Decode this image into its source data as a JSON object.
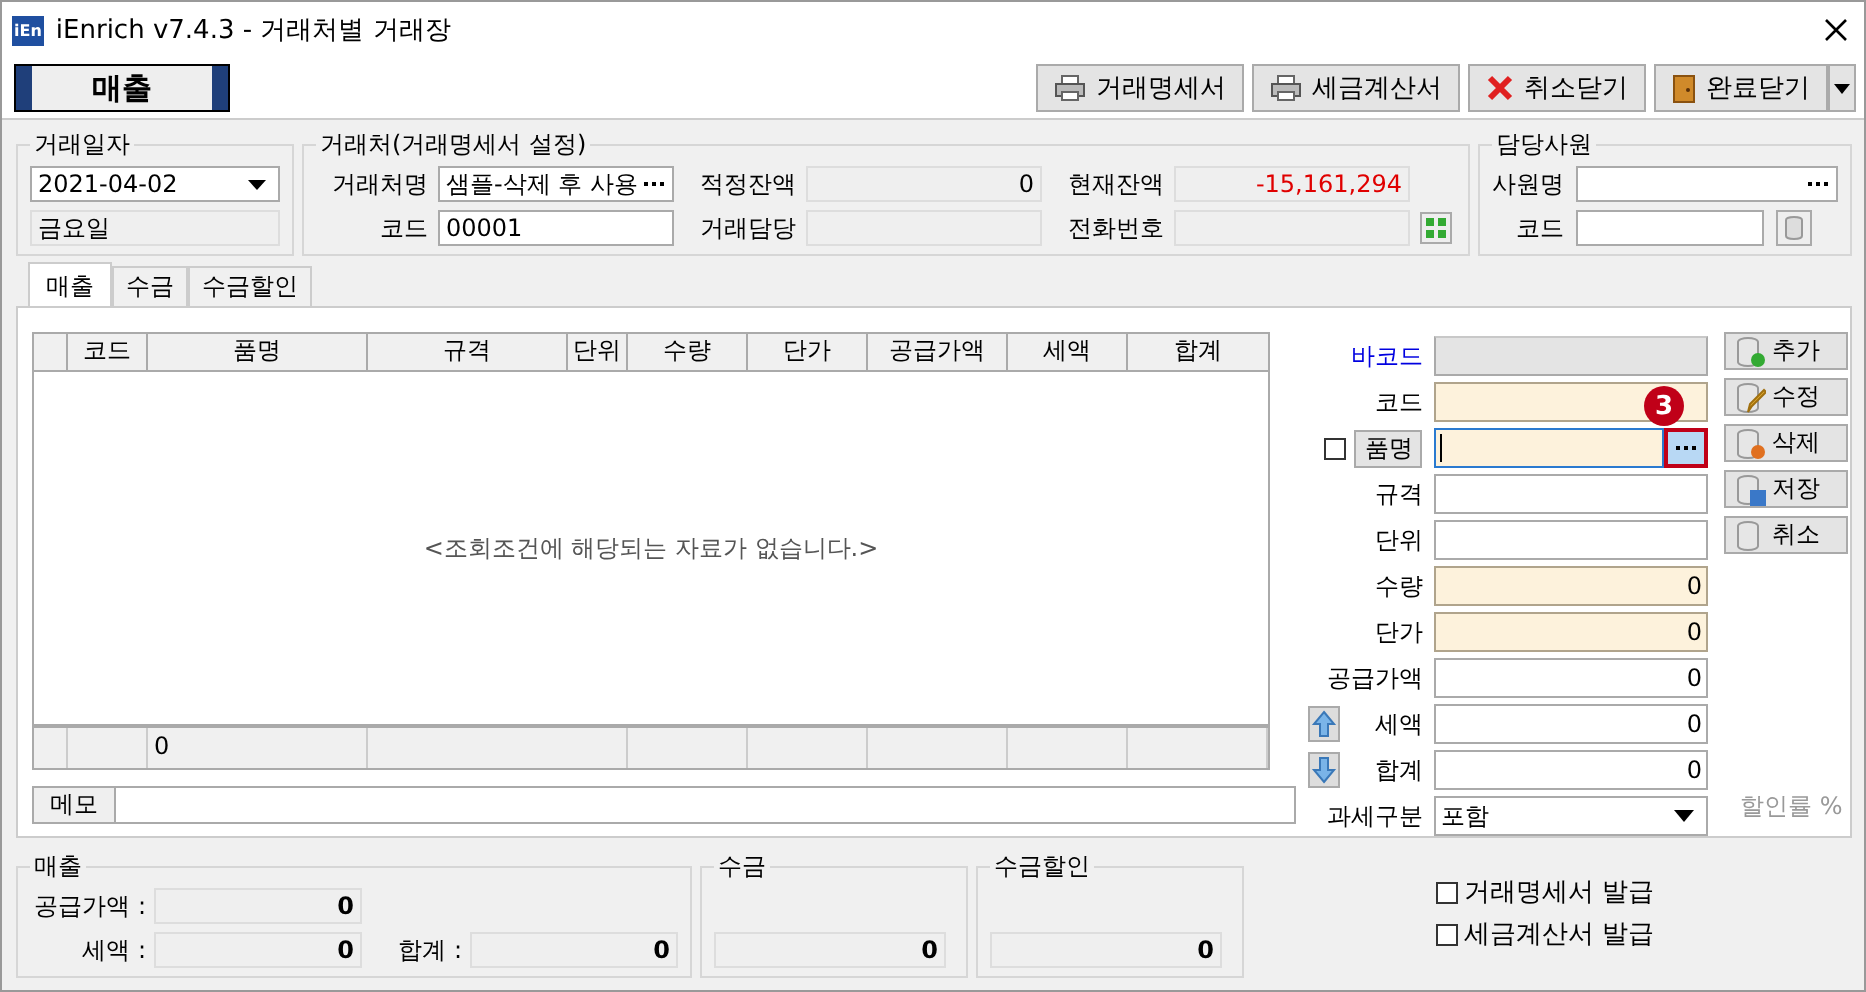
{
  "window": {
    "title": "iEnrich v7.4.3 - 거래처별 거래장",
    "logo": "iEn"
  },
  "mode_label": "매출",
  "toolbar": [
    {
      "label": "거래명세서",
      "kind": "print"
    },
    {
      "label": "세금계산서",
      "kind": "print"
    },
    {
      "label": "취소닫기",
      "kind": "cancel"
    },
    {
      "label": "완료닫기",
      "kind": "door"
    }
  ],
  "date_group": {
    "title": "거래일자",
    "date": "2021-04-02",
    "weekday": "금요일"
  },
  "client_group": {
    "title": "거래처(거래명세서 설정)",
    "name_label": "거래처명",
    "name": "샘플-삭제 후 사용",
    "code_label": "코드",
    "code": "00001",
    "balance_label": "적정잔액",
    "balance": "0",
    "manager_label": "거래담당",
    "current_label": "현재잔액",
    "current": "-15,161,294",
    "phone_label": "전화번호"
  },
  "staff_group": {
    "title": "담당사원",
    "name_label": "사원명",
    "code_label": "코드"
  },
  "tabs": [
    {
      "label": "매출",
      "selected": true
    },
    {
      "label": "수금",
      "selected": false
    },
    {
      "label": "수금할인",
      "selected": false
    }
  ],
  "table": {
    "columns": [
      "코드",
      "품명",
      "규격",
      "단위",
      "수량",
      "단가",
      "공급가액",
      "세액",
      "합계"
    ],
    "empty_message": "<조회조건에 해당되는 자료가 없습니다.>",
    "footer_value": "0"
  },
  "memo_label": "메모",
  "form": [
    {
      "label": "바코드",
      "kind": "link",
      "disabled": true,
      "required": false,
      "focused": false
    },
    {
      "label": "코드",
      "kind": "text",
      "disabled": false,
      "required": true,
      "focused": false
    },
    {
      "label": "품명",
      "kind": "lookup",
      "disabled": false,
      "required": true,
      "focused": true,
      "checked": false,
      "callout": "3"
    },
    {
      "label": "규격",
      "kind": "text",
      "disabled": false,
      "required": false,
      "focused": false
    },
    {
      "label": "단위",
      "kind": "text",
      "disabled": false,
      "required": false,
      "focused": false
    },
    {
      "label": "수량",
      "kind": "text",
      "disabled": false,
      "required": true,
      "focused": false,
      "value": "0"
    },
    {
      "label": "단가",
      "kind": "text",
      "disabled": false,
      "required": true,
      "focused": false,
      "value": "0"
    },
    {
      "label": "공급가액",
      "kind": "text",
      "disabled": false,
      "required": false,
      "focused": false,
      "value": "0"
    },
    {
      "label": "세액",
      "kind": "up",
      "disabled": false,
      "required": false,
      "focused": false,
      "value": "0"
    },
    {
      "label": "합계",
      "kind": "down",
      "disabled": false,
      "required": false,
      "focused": false,
      "value": "0"
    }
  ],
  "side_buttons": [
    {
      "label": "추가",
      "kind": "add"
    },
    {
      "label": "수정",
      "kind": "edit"
    },
    {
      "label": "삭제",
      "kind": "delete"
    },
    {
      "label": "저장",
      "kind": "save"
    },
    {
      "label": "취소",
      "kind": "cancel"
    }
  ],
  "tax_type": {
    "label": "과세구분",
    "value": "포함"
  },
  "discount_label": "할인률 %",
  "summary": {
    "sales": {
      "title": "매출",
      "supply_label": "공급가액 :",
      "supply": "0",
      "tax_label": "세액 :",
      "tax": "0",
      "total_label": "합계 :",
      "total": "0"
    },
    "receipt": {
      "title": "수금",
      "value": "0"
    },
    "discount": {
      "title": "수금할인",
      "value": "0"
    }
  },
  "issue_options": [
    {
      "label": "거래명세서 발급",
      "checked": false
    },
    {
      "label": "세금계산서 발급",
      "checked": false
    }
  ]
}
